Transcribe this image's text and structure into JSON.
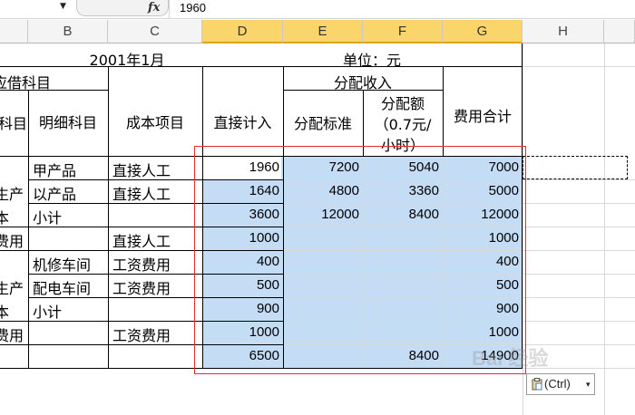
{
  "formula_bar": {
    "dropdown_glyph": "▼",
    "fx_label": "fx",
    "value": "1960"
  },
  "columns": [
    "B",
    "C",
    "D",
    "E",
    "F",
    "G",
    "H"
  ],
  "title_row": {
    "date": "2001年1月",
    "unit": "单位：元"
  },
  "headers": {
    "debit_account": "应借科目",
    "account": "科目",
    "detail_account": "明细科目",
    "cost_item": "成本项目",
    "direct": "直接计入",
    "allocation": "分配收入",
    "alloc_std": "分配标准",
    "alloc_amount_l1": "分配额",
    "alloc_amount_l2": "（0.7元/",
    "alloc_amount_l3": "小时）",
    "total": "费用合计"
  },
  "rows": [
    {
      "a": "",
      "b": "甲产品",
      "c": "直接人工",
      "d": "1960",
      "e": "7200",
      "f": "5040",
      "g": "7000"
    },
    {
      "a": "生产",
      "b": "以产品",
      "c": "直接人工",
      "d": "1640",
      "e": "4800",
      "f": "3360",
      "g": "5000"
    },
    {
      "a": "本",
      "b": "小计",
      "c": "",
      "d": "3600",
      "e": "12000",
      "f": "8400",
      "g": "12000"
    },
    {
      "a": "费用",
      "b": "",
      "c": "直接人工",
      "d": "1000",
      "e": "",
      "f": "",
      "g": "1000"
    },
    {
      "a": "",
      "b": "机修车间",
      "c": "工资费用",
      "d": "400",
      "e": "",
      "f": "",
      "g": "400"
    },
    {
      "a": "生产",
      "b": "配电车间",
      "c": "工资费用",
      "d": "500",
      "e": "",
      "f": "",
      "g": "500"
    },
    {
      "a": "本",
      "b": "小计",
      "c": "",
      "d": "900",
      "e": "",
      "f": "",
      "g": "900"
    },
    {
      "a": "费用",
      "b": "",
      "c": "工资费用",
      "d": "1000",
      "e": "",
      "f": "",
      "g": "1000"
    },
    {
      "a": "",
      "b": "",
      "c": "",
      "d": "6500",
      "e": "",
      "f": "8400",
      "g": "14900"
    }
  ],
  "paste_options": {
    "label": "(Ctrl)",
    "arrow": "▾"
  },
  "watermark": "Bai 经验",
  "colors": {
    "selection": "#c5dcf5",
    "selected_header": "#f9d56a",
    "highlight_box": "#e03030"
  }
}
